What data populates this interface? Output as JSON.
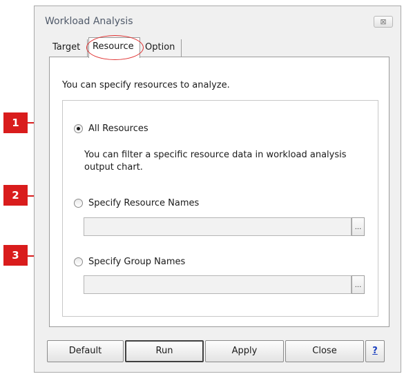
{
  "window": {
    "title": "Workload Analysis",
    "close_glyph": "⊠"
  },
  "tabs": [
    {
      "label": "Target"
    },
    {
      "label": "Resource"
    },
    {
      "label": "Option"
    }
  ],
  "active_tab": "Resource",
  "panel": {
    "intro": "You can specify resources to analyze.",
    "options": [
      {
        "label": "All Resources",
        "checked": true
      },
      {
        "label": "Specify Resource Names",
        "checked": false
      },
      {
        "label": "Specify Group Names",
        "checked": false
      }
    ],
    "help_text": "You can filter a specific resource data in workload analysis output chart.",
    "resource_names_value": "",
    "group_names_value": "",
    "browse_label": "..."
  },
  "buttons": {
    "default": "Default",
    "run": "Run",
    "apply": "Apply",
    "close": "Close",
    "help": "?"
  },
  "callouts": [
    "1",
    "2",
    "3"
  ],
  "colors": {
    "callout": "#d91c1c",
    "highlight_oval": "#e03030",
    "help_link": "#1a3fbf"
  }
}
